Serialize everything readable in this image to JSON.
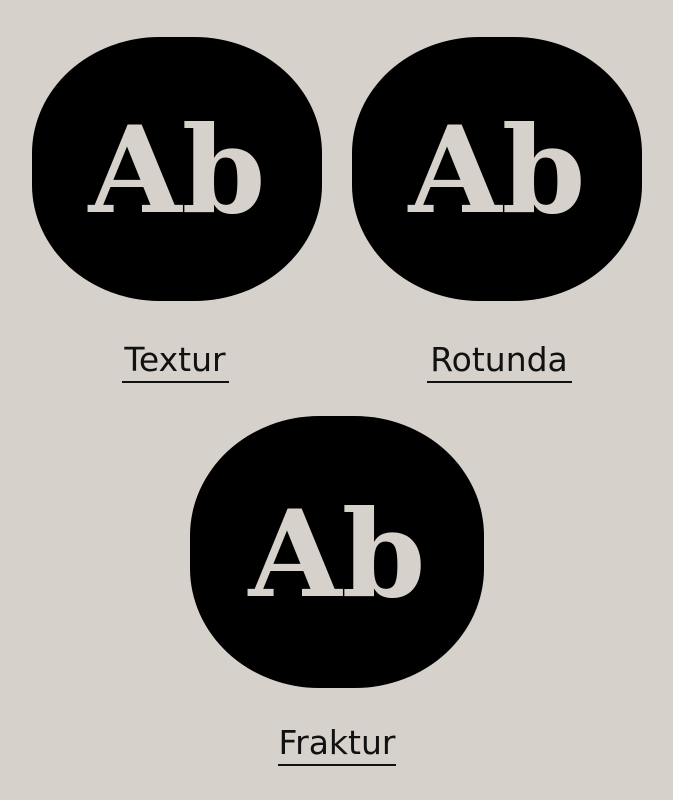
{
  "colors": {
    "background": "#d6d1ca",
    "card": "#000000",
    "glyph": "#d6d1ca",
    "text": "#111111"
  },
  "styles": [
    {
      "specimen": "Ab",
      "name": "Textur"
    },
    {
      "specimen": "Ab",
      "name": "Rotunda"
    },
    {
      "specimen": "Ab",
      "name": "Fraktur"
    }
  ]
}
